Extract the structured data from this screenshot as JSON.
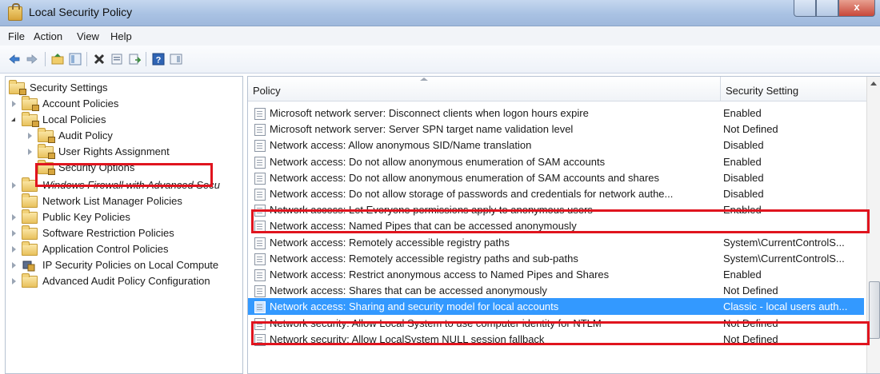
{
  "window": {
    "title": "Local Security Policy",
    "close_glyph": "x"
  },
  "menu": [
    "File",
    "Action",
    "View",
    "Help"
  ],
  "toolbar_icons": [
    "back-arrow-icon",
    "forward-arrow-icon",
    "up-folder-icon",
    "show-hide-tree-icon",
    "delete-icon",
    "properties-icon",
    "export-list-icon",
    "help-icon",
    "toggle-pane-icon"
  ],
  "tree": [
    {
      "label": "Security Settings",
      "icon": "security-settings-icon"
    },
    {
      "label": "Account Policies",
      "icon": "lock-folder-icon"
    },
    {
      "label": "Local Policies",
      "icon": "lock-folder-icon"
    },
    {
      "label": "Audit Policy",
      "icon": "lock-folder-icon"
    },
    {
      "label": "User Rights Assignment",
      "icon": "lock-folder-icon"
    },
    {
      "label": "Security Options",
      "icon": "lock-folder-icon"
    },
    {
      "label": "Windows Firewall with Advanced Secu",
      "icon": "firewall-icon"
    },
    {
      "label": "Network List Manager Policies",
      "icon": "folder-icon"
    },
    {
      "label": "Public Key Policies",
      "icon": "folder-icon"
    },
    {
      "label": "Software Restriction Policies",
      "icon": "folder-icon"
    },
    {
      "label": "Application Control Policies",
      "icon": "folder-icon"
    },
    {
      "label": "IP Security Policies on Local Compute",
      "icon": "ipsec-icon"
    },
    {
      "label": "Advanced Audit Policy Configuration",
      "icon": "folder-icon"
    }
  ],
  "columns": {
    "policy": "Policy",
    "setting": "Security Setting"
  },
  "rows": [
    {
      "policy": "Microsoft network server: Disconnect clients when logon hours expire",
      "setting": "Enabled"
    },
    {
      "policy": "Microsoft network server: Server SPN target name validation level",
      "setting": "Not Defined"
    },
    {
      "policy": "Network access: Allow anonymous SID/Name translation",
      "setting": "Disabled"
    },
    {
      "policy": "Network access: Do not allow anonymous enumeration of SAM accounts",
      "setting": "Enabled"
    },
    {
      "policy": "Network access: Do not allow anonymous enumeration of SAM accounts and shares",
      "setting": "Disabled"
    },
    {
      "policy": "Network access: Do not allow storage of passwords and credentials for network authe...",
      "setting": "Disabled"
    },
    {
      "policy": "Network access: Let Everyone permissions apply to anonymous users",
      "setting": "Enabled"
    },
    {
      "policy": "Network access: Named Pipes that can be accessed anonymously",
      "setting": ""
    },
    {
      "policy": "Network access: Remotely accessible registry paths",
      "setting": "System\\CurrentControlS..."
    },
    {
      "policy": "Network access: Remotely accessible registry paths and sub-paths",
      "setting": "System\\CurrentControlS..."
    },
    {
      "policy": "Network access: Restrict anonymous access to Named Pipes and Shares",
      "setting": "Enabled"
    },
    {
      "policy": "Network access: Shares that can be accessed anonymously",
      "setting": "Not Defined"
    },
    {
      "policy": "Network access: Sharing and security model for local accounts",
      "setting": "Classic - local users auth..."
    },
    {
      "policy": "Network security: Allow Local System to use computer identity for NTLM",
      "setting": "Not Defined"
    },
    {
      "policy": "Network security: Allow LocalSystem NULL session fallback",
      "setting": "Not Defined"
    }
  ],
  "selected_row": "Network access: Sharing and security model for local accounts",
  "highlight_color": "#e0141e",
  "selection_color": "#3399ff"
}
